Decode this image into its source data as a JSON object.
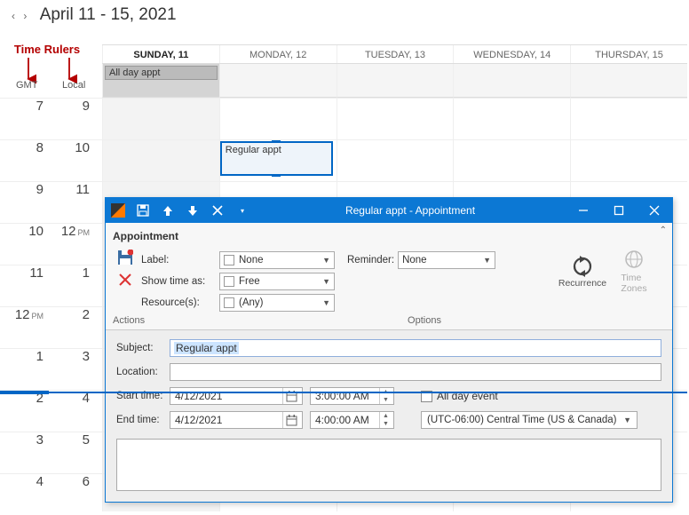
{
  "header": {
    "date_range": "April 11 - 15, 2021"
  },
  "callout": {
    "label": "Time Rulers"
  },
  "ruler": {
    "col1": "GMT",
    "col2": "Local"
  },
  "days": [
    {
      "label": "SUNDAY, 11",
      "today": true
    },
    {
      "label": "MONDAY, 12"
    },
    {
      "label": "TUESDAY, 13"
    },
    {
      "label": "WEDNESDAY, 14"
    },
    {
      "label": "THURSDAY, 15"
    }
  ],
  "allday": {
    "item": "All day appt"
  },
  "times": [
    {
      "gmt": "7",
      "local": "9"
    },
    {
      "gmt": "8",
      "local": "10"
    },
    {
      "gmt": "9",
      "local": "11"
    },
    {
      "gmt": "10",
      "local": "12",
      "local_ampm": "PM"
    },
    {
      "gmt": "11",
      "local": "1"
    },
    {
      "gmt": "12",
      "gmt_ampm": "PM",
      "local": "2"
    },
    {
      "gmt": "1",
      "local": "3"
    },
    {
      "gmt": "2",
      "local": "4"
    },
    {
      "gmt": "3",
      "local": "5"
    },
    {
      "gmt": "4",
      "local": "6"
    }
  ],
  "regular_appt": {
    "label": "Regular appt"
  },
  "dialog": {
    "title": "Regular appt - Appointment",
    "tab": "Appointment",
    "labels": {
      "label": "Label:",
      "showtime": "Show time as:",
      "resources": "Resource(s):",
      "reminder": "Reminder:",
      "recurrence": "Recurrence",
      "timezones": "Time\nZones",
      "actions": "Actions",
      "options": "Options"
    },
    "combos": {
      "label_val": "None",
      "showtime_val": "Free",
      "resources_val": "(Any)",
      "reminder_val": "None"
    },
    "form": {
      "subject_lab": "Subject:",
      "subject_val": "Regular appt",
      "location_lab": "Location:",
      "start_lab": "Start time:",
      "end_lab": "End time:",
      "start_date": "4/12/2021",
      "start_time": "3:00:00 AM",
      "end_date": "4/12/2021",
      "end_time": "4:00:00 AM",
      "allday_lab": "All day event",
      "tz_val": "(UTC-06:00) Central Time (US & Canada)"
    }
  }
}
